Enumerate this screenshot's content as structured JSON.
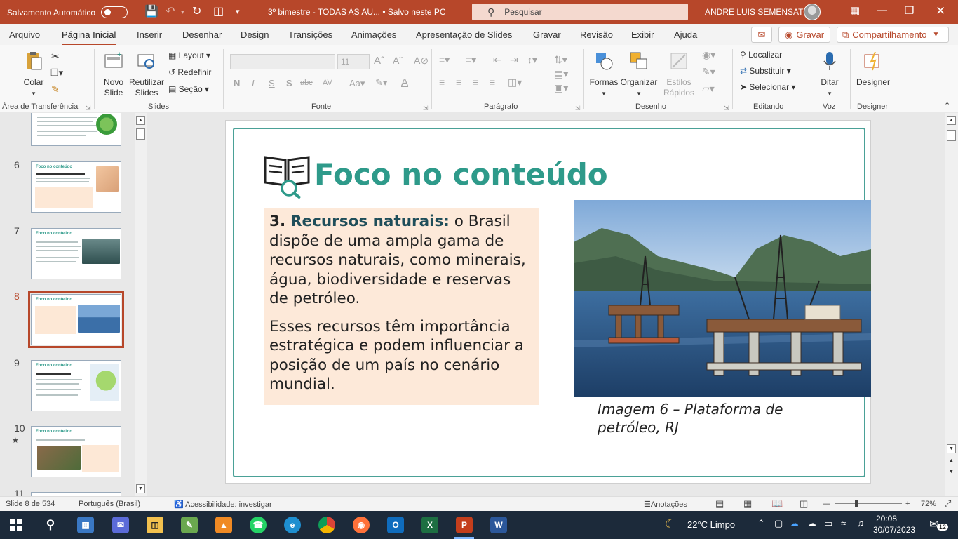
{
  "titlebar": {
    "autosave_label": "Salvamento Automático",
    "doc_title": "3º bimestre - TODAS AS AU...  •  Salvo neste PC",
    "search_placeholder": "Pesquisar",
    "user_name": "ANDRE LUIS SEMENSATO",
    "accent_color": "#b7472a"
  },
  "menu": {
    "tabs": [
      "Arquivo",
      "Página Inicial",
      "Inserir",
      "Desenhar",
      "Design",
      "Transições",
      "Animações",
      "Apresentação de Slides",
      "Gravar",
      "Revisão",
      "Exibir",
      "Ajuda"
    ],
    "active_tab": "Página Inicial",
    "record_label": "Gravar",
    "share_label": "Compartilhamento"
  },
  "ribbon": {
    "groups": {
      "clipboard": "Área de Transferência",
      "slides": "Slides",
      "font": "Fonte",
      "paragraph": "Parágrafo",
      "drawing": "Desenho",
      "editing": "Editando",
      "voice": "Voz",
      "designer": "Designer"
    },
    "paste_label": "Colar",
    "new_slide_label": "Novo Slide",
    "reuse_slides_label": "Reutilizar Slides",
    "layout_label": "Layout",
    "reset_label": "Redefinir",
    "section_label": "Seção",
    "font_size": "11",
    "shapes_label": "Formas",
    "arrange_label": "Organizar",
    "quick_styles_label": "Estilos Rápidos",
    "find_label": "Localizar",
    "replace_label": "Substituir",
    "select_label": "Selecionar",
    "dictate_label": "Ditar",
    "designer_label": "Designer",
    "bold_glyph": "N",
    "italic_glyph": "I",
    "underline_glyph": "S",
    "shadow_glyph": "S",
    "strike_glyph": "abc",
    "spacing_glyph": "AV"
  },
  "thumbnails": {
    "numbers": [
      "6",
      "7",
      "8",
      "9",
      "10",
      "11"
    ],
    "selected": "8",
    "star_marker": "★",
    "titles": [
      "Foco no conteúdo",
      "Foco no conteúdo",
      "Foco no conteúdo",
      "Foco no conteúdo",
      "Foco no conteúdo"
    ]
  },
  "slide": {
    "title": "Foco no conteúdo",
    "item_number": "3.",
    "item_heading": "Recursos naturais:",
    "paragraph1_rest": " o Brasil dispõe de uma ampla gama de recursos naturais, como minerais, água, biodiversidade e reservas de petróleo.",
    "paragraph2": "Esses recursos têm importância estratégica e podem influenciar a posição de um país no cenário mundial.",
    "caption": "Imagem 6 – Plataforma de petróleo, RJ",
    "title_color": "#2e9a8a",
    "box_color": "#fde9d9"
  },
  "statusbar": {
    "slide_info": "Slide 8 de 534",
    "language": "Português (Brasil)",
    "accessibility": "Acessibilidade: investigar",
    "notes_label": "Anotações",
    "zoom": "72%"
  },
  "taskbar": {
    "weather": "22°C  Limpo",
    "time": "20:08",
    "date": "30/07/2023",
    "notifications": "12"
  }
}
